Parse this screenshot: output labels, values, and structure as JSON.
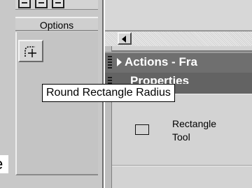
{
  "options_panel": {
    "header": "Options",
    "modifier_icon": "round-rectangle-radius-icon"
  },
  "tooltip": {
    "text": "Round Rectangle Radius"
  },
  "panels": {
    "actions_title": "Actions - Fra",
    "properties_title": "Properties"
  },
  "properties": {
    "tool_icon": "rectangle-icon",
    "tool_name": "Rectangle Tool"
  },
  "left_fragment": "e",
  "colors": {
    "panel_header_bg": "#6f6f6f",
    "toolbox_bg": "#c8c8c8",
    "tooltip_bg": "#ffffff"
  }
}
